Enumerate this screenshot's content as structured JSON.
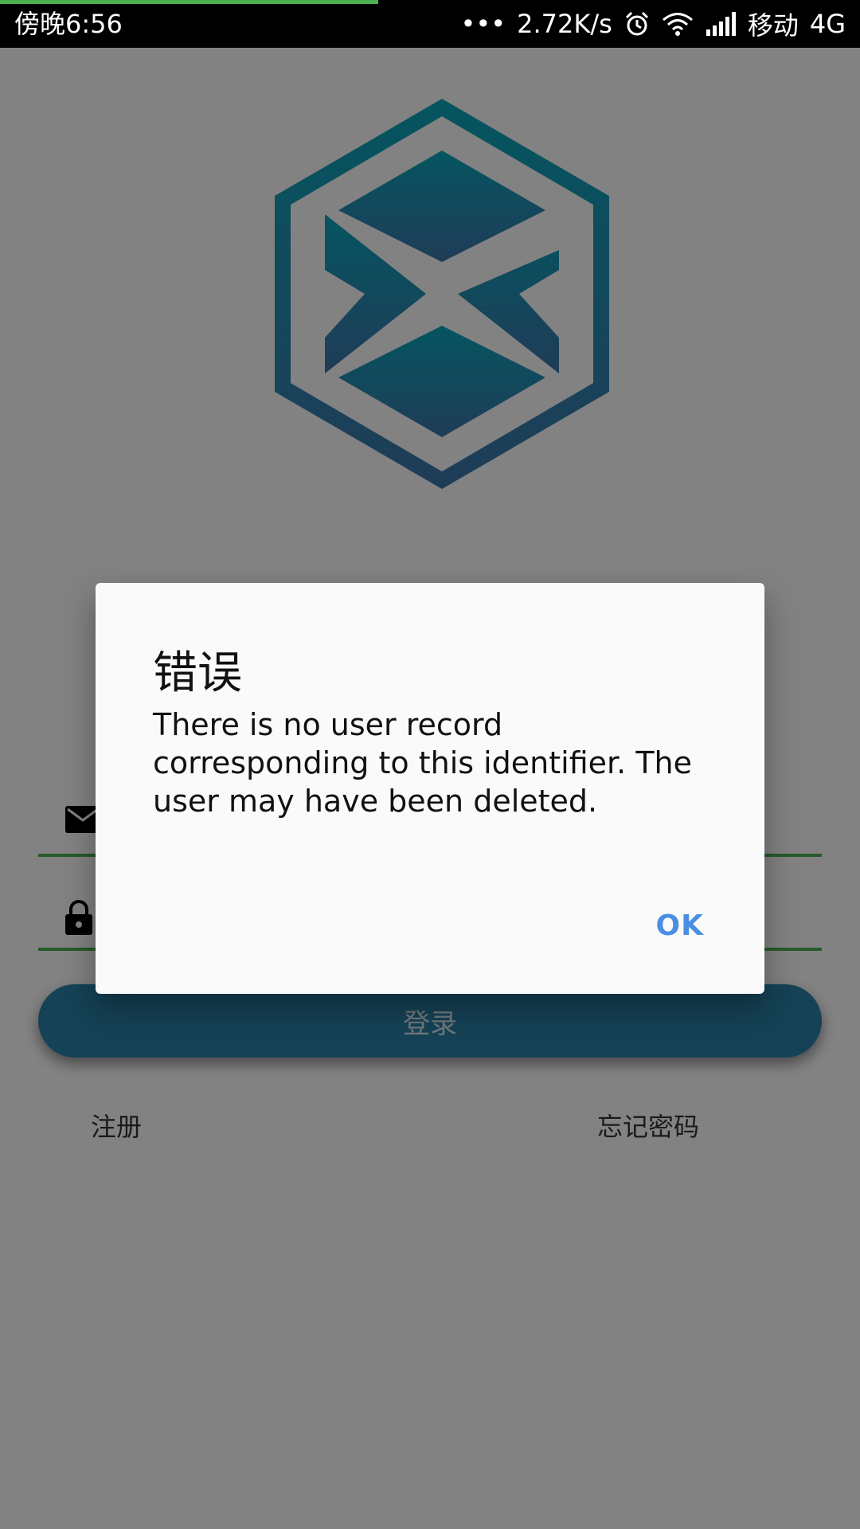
{
  "status_bar": {
    "time": "傍晚6:56",
    "more": "•••",
    "net_speed": "2.72K/s",
    "carrier": "移动",
    "network_type": "4G",
    "icons": [
      "more-dots-icon",
      "alarm-icon",
      "wifi-icon",
      "signal-icon"
    ],
    "progress_fraction": 0.44
  },
  "app": {
    "logo": "hexagon-logo-icon",
    "title": "",
    "email_placeholder": "",
    "password_placeholder": "",
    "login_label": "登录",
    "register_label": "注册",
    "forgot_label": "忘记密码"
  },
  "dialog": {
    "title": "错误",
    "message": "There is no user record corresponding to this identifier. The user may have been deleted.",
    "ok_label": "OK"
  },
  "colors": {
    "accent_green": "#4caf50",
    "brand_blue": "#2a7fa6",
    "dialog_button": "#4a8fe2"
  }
}
